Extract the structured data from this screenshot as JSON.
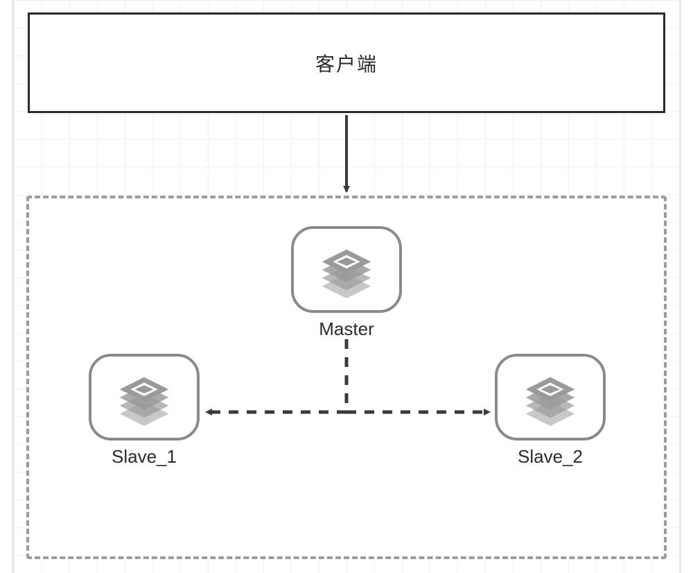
{
  "diagram": {
    "client_label": "客户端",
    "nodes": {
      "master": {
        "label": "Master"
      },
      "slave1": {
        "label": "Slave_1"
      },
      "slave2": {
        "label": "Slave_2"
      }
    },
    "connections": [
      {
        "from": "client",
        "to": "master",
        "style": "solid",
        "direction": "down"
      },
      {
        "from": "master",
        "to": "slave1",
        "style": "dashed",
        "direction": "bidirectional-left"
      },
      {
        "from": "master",
        "to": "slave2",
        "style": "dashed",
        "direction": "bidirectional-right"
      }
    ]
  },
  "colors": {
    "border_dark": "#2a2a2a",
    "border_gray": "#8a8a8a",
    "dashed_gray": "#9c9c9c",
    "arrow": "#3a3a3a",
    "icon": "#9a9a9a"
  }
}
